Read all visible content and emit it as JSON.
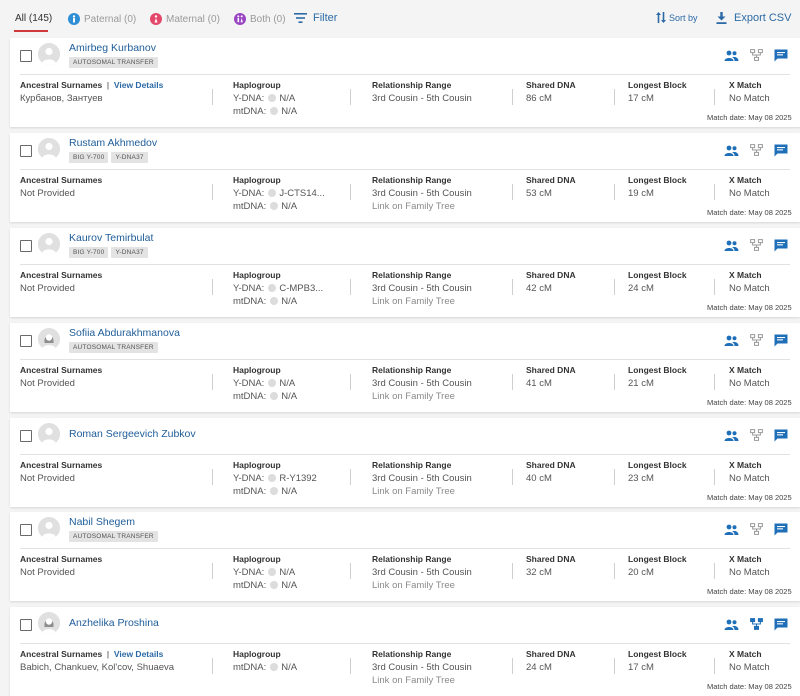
{
  "filters": {
    "all": "All (145)",
    "paternal": "Paternal (0)",
    "maternal": "Maternal (0)",
    "both": "Both (0)",
    "filter": "Filter"
  },
  "toolbar": {
    "sort": "Sort by",
    "export": "Export CSV"
  },
  "labels": {
    "ancestral": "Ancestral Surnames",
    "view_details": "View Details",
    "haplogroup": "Haplogroup",
    "ydna": "Y-DNA:",
    "mtdna": "mtDNA:",
    "relationship": "Relationship Range",
    "family_tree_link": "Link on Family Tree",
    "shared": "Shared DNA",
    "longest": "Longest Block",
    "xmatch": "X Match"
  },
  "colors": {
    "accent": "#d0383b",
    "link": "#1f5d99",
    "icon": "#1f6fb8",
    "icon_muted": "#9a9a9a"
  },
  "matches": [
    {
      "name": "Amirbeg Kurbanov",
      "badges": [
        "AUTOSOMAL TRANSFER"
      ],
      "avatar": "male",
      "surnames": "Курбанов, Зантуев",
      "view_details": true,
      "ydna": "N/A",
      "mtdna": "N/A",
      "relationship": "3rd Cousin - 5th Cousin",
      "family_tree_link": false,
      "shared_dna": "86 cM",
      "longest_block": "17 cM",
      "x_match": "No Match",
      "match_date": "Match date: May 08 2025",
      "tree_icon_active": false
    },
    {
      "name": "Rustam Akhmedov",
      "badges": [
        "BIG Y-700",
        "Y-DNA37"
      ],
      "avatar": "male",
      "surnames": "Not Provided",
      "view_details": false,
      "ydna": "J-CTS14...",
      "mtdna": "N/A",
      "relationship": "3rd Cousin - 5th Cousin",
      "family_tree_link": true,
      "shared_dna": "53 cM",
      "longest_block": "19 cM",
      "x_match": "No Match",
      "match_date": "Match date: May 08 2025",
      "tree_icon_active": false
    },
    {
      "name": "Kaurov Temirbulat",
      "badges": [
        "BIG Y-700",
        "Y-DNA37"
      ],
      "avatar": "male",
      "surnames": "Not Provided",
      "view_details": false,
      "ydna": "C-MPB3...",
      "mtdna": "N/A",
      "relationship": "3rd Cousin - 5th Cousin",
      "family_tree_link": true,
      "shared_dna": "42 cM",
      "longest_block": "24 cM",
      "x_match": "No Match",
      "match_date": "Match date: May 08 2025",
      "tree_icon_active": false
    },
    {
      "name": "Sofiia Abdurakhmanova",
      "badges": [
        "AUTOSOMAL TRANSFER"
      ],
      "avatar": "female",
      "surnames": "Not Provided",
      "view_details": false,
      "ydna": "N/A",
      "mtdna": "N/A",
      "relationship": "3rd Cousin - 5th Cousin",
      "family_tree_link": true,
      "shared_dna": "41 cM",
      "longest_block": "21 cM",
      "x_match": "No Match",
      "match_date": "Match date: May 08 2025",
      "tree_icon_active": false
    },
    {
      "name": "Roman Sergeevich Zubkov",
      "badges": [],
      "avatar": "male",
      "surnames": "Not Provided",
      "view_details": false,
      "ydna": "R-Y1392",
      "mtdna": "N/A",
      "relationship": "3rd Cousin - 5th Cousin",
      "family_tree_link": true,
      "shared_dna": "40 cM",
      "longest_block": "23 cM",
      "x_match": "No Match",
      "match_date": "Match date: May 08 2025",
      "tree_icon_active": false
    },
    {
      "name": "Nabil Shegem",
      "badges": [
        "AUTOSOMAL TRANSFER"
      ],
      "avatar": "male",
      "surnames": "Not Provided",
      "view_details": false,
      "ydna": "N/A",
      "mtdna": "N/A",
      "relationship": "3rd Cousin - 5th Cousin",
      "family_tree_link": true,
      "shared_dna": "32 cM",
      "longest_block": "20 cM",
      "x_match": "No Match",
      "match_date": "Match date: May 08 2025",
      "tree_icon_active": false
    },
    {
      "name": "Anzhelika Proshina",
      "badges": [],
      "avatar": "female",
      "surnames": "Babich, Chankuev, Kol'cov, Shuaeva",
      "view_details": true,
      "ydna": null,
      "mtdna": "N/A",
      "relationship": "3rd Cousin - 5th Cousin",
      "family_tree_link": true,
      "shared_dna": "24 cM",
      "longest_block": "17 cM",
      "x_match": "No Match",
      "match_date": "Match date: May 08 2025",
      "tree_icon_active": true
    }
  ]
}
